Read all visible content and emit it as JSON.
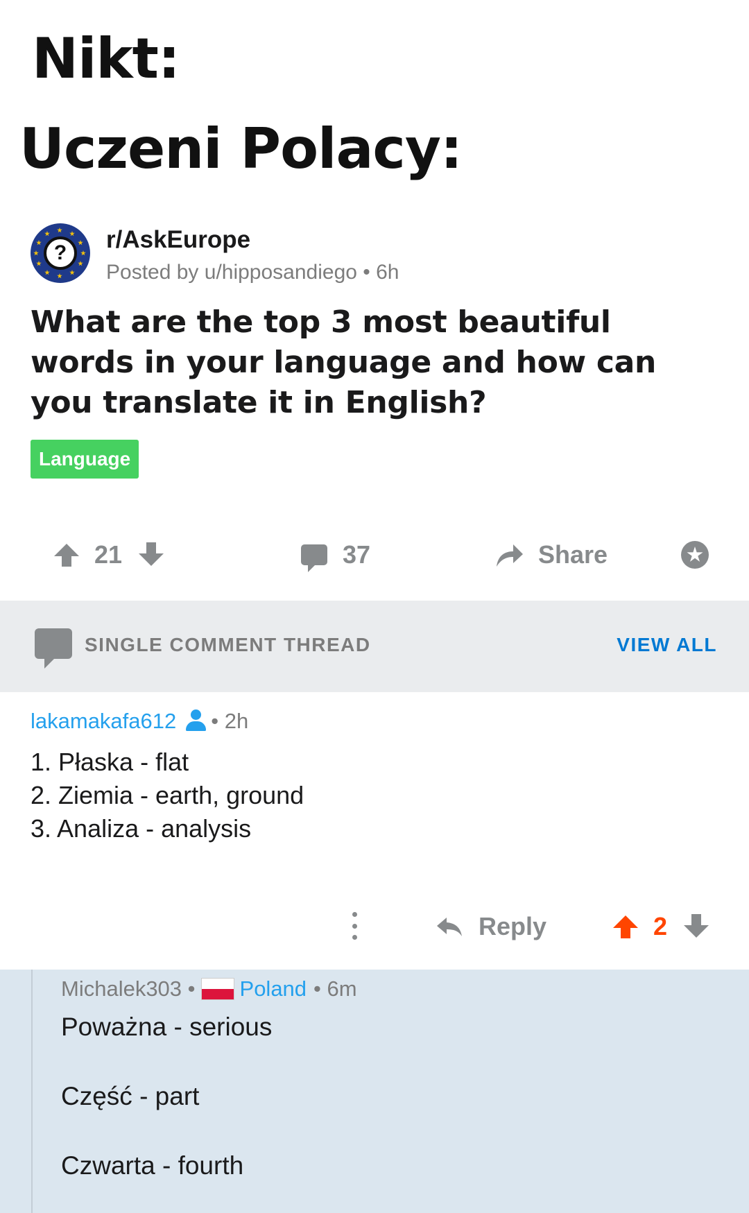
{
  "meme": {
    "line1": "Nikt:",
    "line2": "Uczeni Polacy:"
  },
  "post": {
    "subreddit": "r/AskEurope",
    "meta": "Posted by u/hipposandiego • 6h",
    "title": "What are the top 3 most beautiful words in your language and how can you translate it in English?",
    "flair": "Language",
    "flair_color": "#46d160",
    "votes": "21",
    "comments": "37",
    "share_label": "Share"
  },
  "thread": {
    "label": "SINGLE COMMENT THREAD",
    "view_all": "VIEW ALL",
    "accent": "#0079d3"
  },
  "comment": {
    "author": "lakamakafa612",
    "time": "• 2h",
    "lines": [
      "1. Płaska - flat",
      "2. Ziemia - earth, ground",
      "3. Analiza - analysis"
    ],
    "reply_label": "Reply",
    "votes": "2",
    "upvote_color": "#ff4500"
  },
  "reply": {
    "author": "Michalek303 •",
    "country": "Poland",
    "time": "• 6m",
    "lines": [
      "Poważna  - serious",
      "Część - part",
      "Czwarta - fourth"
    ]
  }
}
